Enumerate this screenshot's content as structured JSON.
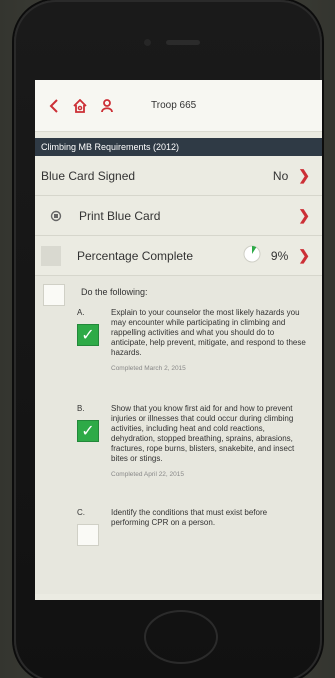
{
  "nav": {
    "title": "Troop 665"
  },
  "section": {
    "header": "Climbing MB Requirements (2012)"
  },
  "rows": {
    "blue_card": {
      "label": "Blue Card Signed",
      "value": "No"
    },
    "print": {
      "label": "Print Blue Card"
    },
    "percentage": {
      "label": "Percentage Complete",
      "value": "9%",
      "progress": 0.09
    }
  },
  "requirements": {
    "intro": "Do the following:",
    "items": [
      {
        "letter": "A.",
        "text": "Explain to your counselor the most likely hazards you may encounter while participating in climbing and rappelling activities and what you should do to anticipate, help prevent, mitigate, and respond to these hazards.",
        "completed": "Completed March 2, 2015",
        "checked": true
      },
      {
        "letter": "B.",
        "text": "Show that you know first aid for and how to prevent injuries or illnesses that could occur during climbing activities, including heat and cold reactions, dehydration, stopped breathing, sprains, abrasions, fractures, rope burns, blisters, snakebite, and insect bites or stings.",
        "completed": "Completed April 22, 2015",
        "checked": true
      },
      {
        "letter": "C.",
        "text": "Identify the conditions that must exist before performing CPR on a person.",
        "completed": "",
        "checked": false
      }
    ]
  },
  "colors": {
    "accent": "#cc2f36",
    "header_bg": "#2f3a45",
    "check_green": "#2eaa47"
  }
}
